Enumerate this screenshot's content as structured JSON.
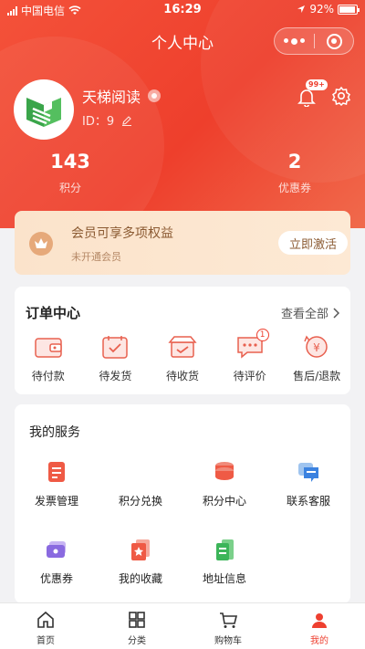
{
  "status_bar": {
    "carrier": "中国电信",
    "time": "16:29",
    "battery": "92%"
  },
  "nav": {
    "title": "个人中心"
  },
  "profile": {
    "name": "天梯阅读",
    "id_label": "ID：9",
    "notification_badge": "99+"
  },
  "stats": [
    {
      "value": "143",
      "label": "积分"
    },
    {
      "value": "2",
      "label": "优惠券"
    }
  ],
  "member": {
    "title": "会员可享多项权益",
    "subtitle": "未开通会员",
    "button": "立即激活"
  },
  "orders": {
    "title": "订单中心",
    "view_all": "查看全部",
    "items": [
      {
        "label": "待付款",
        "badge": ""
      },
      {
        "label": "待发货",
        "badge": ""
      },
      {
        "label": "待收货",
        "badge": ""
      },
      {
        "label": "待评价",
        "badge": "1"
      },
      {
        "label": "售后/退款",
        "badge": ""
      }
    ]
  },
  "services": {
    "title": "我的服务",
    "items": [
      {
        "label": "发票管理",
        "icon": "invoice-icon"
      },
      {
        "label": "积分兑换",
        "icon": "points-exchange-icon"
      },
      {
        "label": "积分中心",
        "icon": "points-center-icon"
      },
      {
        "label": "联系客服",
        "icon": "customer-service-icon"
      },
      {
        "label": "优惠券",
        "icon": "coupon-icon"
      },
      {
        "label": "我的收藏",
        "icon": "favorites-icon"
      },
      {
        "label": "地址信息",
        "icon": "address-icon"
      }
    ]
  },
  "tabbar": [
    {
      "label": "首页",
      "icon": "home-icon"
    },
    {
      "label": "分类",
      "icon": "category-icon"
    },
    {
      "label": "购物车",
      "icon": "cart-icon"
    },
    {
      "label": "我的",
      "icon": "profile-icon"
    }
  ],
  "colors": {
    "primary": "#ee4030",
    "member_gold": "#8b5a32",
    "member_bg": "#fbe3cb"
  }
}
